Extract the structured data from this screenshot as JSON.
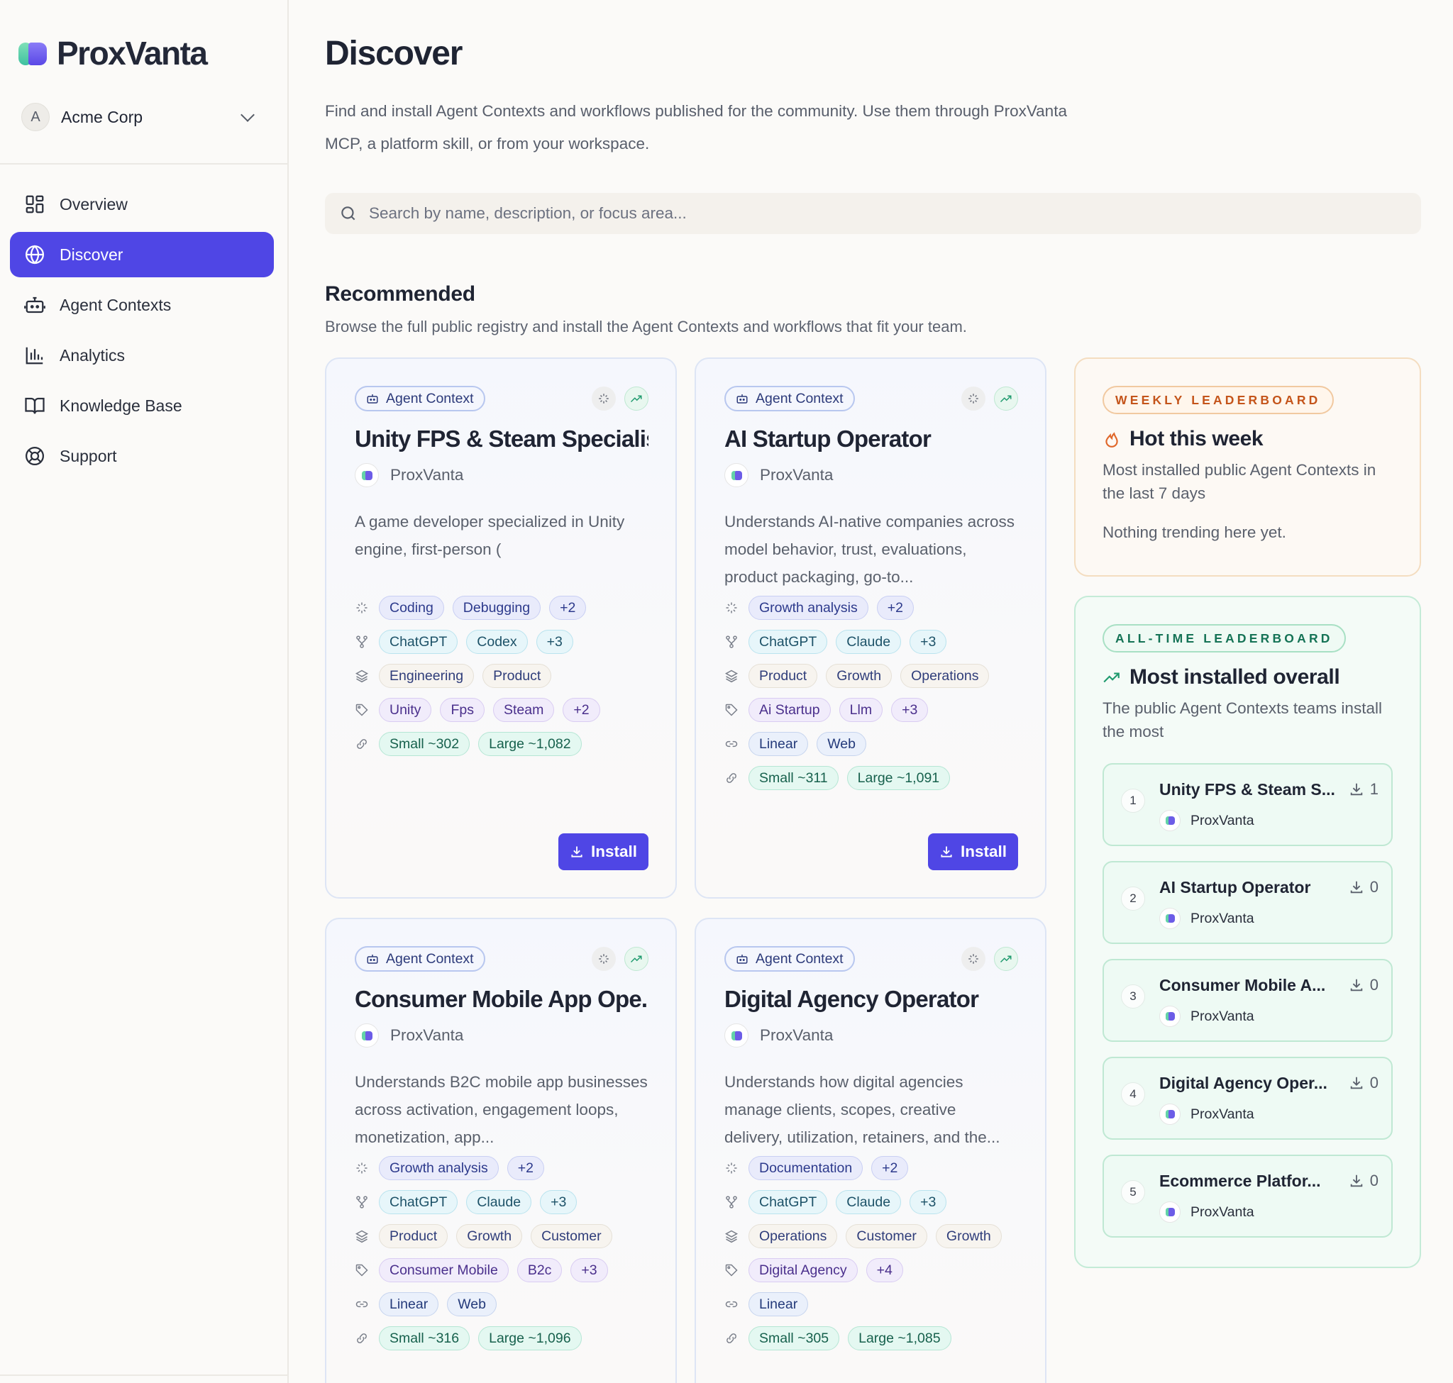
{
  "brand": {
    "name": "ProxVanta"
  },
  "workspace": {
    "initial": "A",
    "name": "Acme Corp"
  },
  "nav": [
    {
      "label": "Overview",
      "icon": "grid-icon",
      "active": false
    },
    {
      "label": "Discover",
      "icon": "globe-icon",
      "active": true
    },
    {
      "label": "Agent Contexts",
      "icon": "bot-icon",
      "active": false
    },
    {
      "label": "Analytics",
      "icon": "bar-chart-icon",
      "active": false
    },
    {
      "label": "Knowledge Base",
      "icon": "book-icon",
      "active": false
    },
    {
      "label": "Support",
      "icon": "lifebuoy-icon",
      "active": false
    }
  ],
  "page": {
    "title": "Discover",
    "description": "Find and install Agent Contexts and workflows published for the community. Use them through ProxVanta MCP, a platform skill, or from your workspace."
  },
  "search": {
    "placeholder": "Search by name, description, or focus area...",
    "value": ""
  },
  "recommended": {
    "title": "Recommended",
    "subtitle": "Browse the full public registry and install the Agent Contexts and workflows that fit your team.",
    "install_label": "Install",
    "cards": [
      {
        "type": "Agent Context",
        "title": "Unity FPS & Steam Specialist",
        "publisher": "ProxVanta",
        "description": "A game developer specialized in Unity engine, first-person (",
        "focus": [
          "Coding",
          "Debugging",
          "+2"
        ],
        "models": [
          "ChatGPT",
          "Codex",
          "+3"
        ],
        "departments": [
          "Engineering",
          "Product"
        ],
        "keywords": [
          "Unity",
          "Fps",
          "Steam",
          "+2"
        ],
        "integrations": [],
        "sizes": [
          "Small ~302",
          "Large ~1,082"
        ]
      },
      {
        "type": "Agent Context",
        "title": "AI Startup Operator",
        "publisher": "ProxVanta",
        "description": "Understands AI-native companies across model behavior, trust, evaluations, product packaging, go-to...",
        "focus": [
          "Growth analysis",
          "+2"
        ],
        "models": [
          "ChatGPT",
          "Claude",
          "+3"
        ],
        "departments": [
          "Product",
          "Growth",
          "Operations"
        ],
        "keywords": [
          "Ai Startup",
          "Llm",
          "+3"
        ],
        "integrations": [
          "Linear",
          "Web"
        ],
        "sizes": [
          "Small ~311",
          "Large ~1,091"
        ]
      },
      {
        "type": "Agent Context",
        "title": "Consumer Mobile App Ope...",
        "publisher": "ProxVanta",
        "description": "Understands B2C mobile app businesses across activation, engagement loops, monetization, app...",
        "focus": [
          "Growth analysis",
          "+2"
        ],
        "models": [
          "ChatGPT",
          "Claude",
          "+3"
        ],
        "departments": [
          "Product",
          "Growth",
          "Customer"
        ],
        "keywords": [
          "Consumer Mobile",
          "B2c",
          "+3"
        ],
        "integrations": [
          "Linear",
          "Web"
        ],
        "sizes": [
          "Small ~316",
          "Large ~1,096"
        ]
      },
      {
        "type": "Agent Context",
        "title": "Digital Agency Operator",
        "publisher": "ProxVanta",
        "description": "Understands how digital agencies manage clients, scopes, creative delivery, utilization, retainers, and the...",
        "focus": [
          "Documentation",
          "+2"
        ],
        "models": [
          "ChatGPT",
          "Claude",
          "+3"
        ],
        "departments": [
          "Operations",
          "Customer",
          "Growth"
        ],
        "keywords": [
          "Digital Agency",
          "+4"
        ],
        "integrations": [
          "Linear"
        ],
        "sizes": [
          "Small ~305",
          "Large ~1,085"
        ]
      }
    ]
  },
  "weekly": {
    "badge": "WEEKLY LEADERBOARD",
    "title": "Hot this week",
    "description": "Most installed public Agent Contexts in the last 7 days",
    "empty": "Nothing trending here yet."
  },
  "alltime": {
    "badge": "ALL-TIME LEADERBOARD",
    "title": "Most installed overall",
    "description": "The public Agent Contexts teams install the most",
    "items": [
      {
        "rank": "1",
        "name": "Unity FPS & Steam S...",
        "publisher": "ProxVanta",
        "installs": "1"
      },
      {
        "rank": "2",
        "name": "AI Startup Operator",
        "publisher": "ProxVanta",
        "installs": "0"
      },
      {
        "rank": "3",
        "name": "Consumer Mobile A...",
        "publisher": "ProxVanta",
        "installs": "0"
      },
      {
        "rank": "4",
        "name": "Digital Agency Oper...",
        "publisher": "ProxVanta",
        "installs": "0"
      },
      {
        "rank": "5",
        "name": "Ecommerce Platfor...",
        "publisher": "ProxVanta",
        "installs": "0"
      }
    ]
  },
  "colors": {
    "accent": "#4f46e5",
    "weekly_accent": "#c4541a",
    "alltime_accent": "#157356"
  }
}
